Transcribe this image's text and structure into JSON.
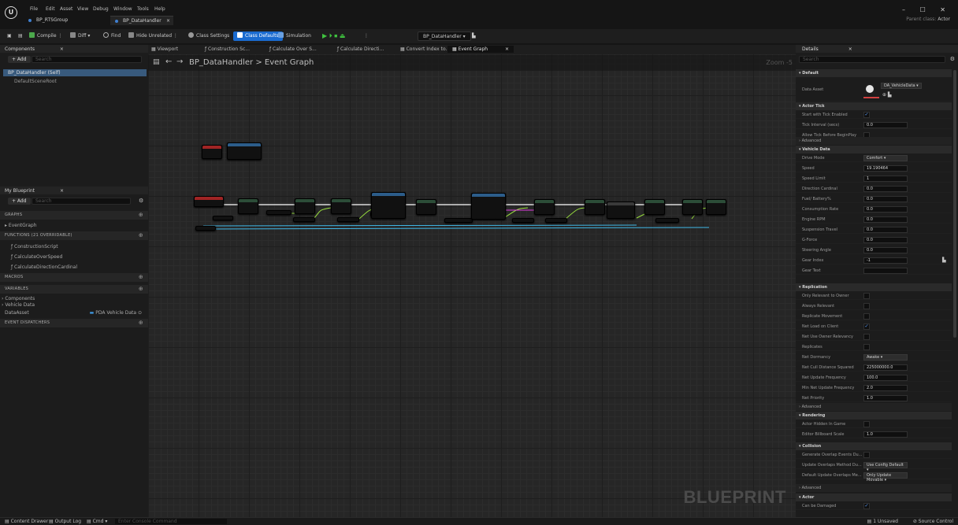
{
  "menu": [
    "File",
    "Edit",
    "Asset",
    "View",
    "Debug",
    "Window",
    "Tools",
    "Help"
  ],
  "doc_tabs": [
    {
      "label": "BP_RTSGroup",
      "color": "#3f7fd0"
    },
    {
      "label": "BP_DataHandler",
      "color": "#3f7fd0"
    }
  ],
  "doc_tab_close": "×",
  "window_controls": "–  ☐  ✕",
  "parent_class": {
    "label": "Parent class:",
    "value": "Actor"
  },
  "toolbar": {
    "compile": "Compile",
    "diff": "Diff ▾",
    "find": "Find",
    "hide_unrelated": "Hide Unrelated",
    "class_settings": "Class Settings",
    "class_defaults": "Class Defaults",
    "simulation": "Simulation",
    "play_controls": "▶ ⏵ ⏹ ⏏",
    "debug_target": "BP_DataHandler ▾"
  },
  "components": {
    "tab": "Components",
    "add": "+ Add",
    "search_placeholder": "Search",
    "self": "BP_DataHandler (Self)",
    "root": "DefaultSceneRoot"
  },
  "my_blueprint": {
    "tab": "My Blueprint",
    "add": "+ Add",
    "search_placeholder": "Search",
    "graphs_label": "GRAPHS",
    "event_graph": "EventGraph",
    "functions_label": "FUNCTIONS (21 OVERRIDABLE)",
    "functions": [
      "ConstructionScript",
      "CalculateOverSpeed",
      "CalculateDirectionCardinal"
    ],
    "macros_label": "MACROS",
    "variables_label": "VARIABLES",
    "var_groups": [
      "Components",
      "Vehicle Data"
    ],
    "variable": {
      "name": "DataAsset",
      "type": "PDA Vehicle Data"
    },
    "dispatchers_label": "EVENT DISPATCHERS"
  },
  "graph": {
    "tabs": [
      "Viewport",
      "Construction Sc...",
      "Calculate Over S...",
      "Calculate Directi...",
      "Convert Index to...",
      "Event Graph"
    ],
    "tab_close": "×",
    "breadcrumb": "BP_DataHandler > Event Graph",
    "zoom": "Zoom -5",
    "watermark": "BLUEPRINT"
  },
  "details": {
    "tab": "Details",
    "search_placeholder": "Search",
    "sections": {
      "default": "Default",
      "actor_tick": "Actor Tick",
      "advanced": "Advanced",
      "vehicle_data": "Vehicle Data",
      "replication": "Replication",
      "rendering": "Rendering",
      "collision": "Collision",
      "actor": "Actor"
    },
    "data_asset": {
      "label": "Data Asset",
      "value": "DA_VehicleData"
    },
    "tick": [
      {
        "label": "Start with Tick Enabled",
        "check": "✓"
      },
      {
        "label": "Tick Interval (secs)",
        "value": "0.0"
      },
      {
        "label": "Allow Tick Before BeginPlay",
        "check": ""
      }
    ],
    "vehicle": [
      {
        "label": "Drive Mode",
        "drop": "Comfort ▾"
      },
      {
        "label": "Speed",
        "value": "19.190464"
      },
      {
        "label": "Speed Limit",
        "value": "1"
      },
      {
        "label": "Direction Cardinal",
        "value": "0.0"
      },
      {
        "label": "Fuel/ Battery%",
        "value": "0.0"
      },
      {
        "label": "Consumption Rate",
        "value": "0.0"
      },
      {
        "label": "Engine RPM",
        "value": "0.0"
      },
      {
        "label": "Suspension Travel",
        "value": "0.0"
      },
      {
        "label": "G-Force",
        "value": "0.0"
      },
      {
        "label": "Steering Angle",
        "value": "0.0"
      },
      {
        "label": "Gear Index",
        "value": "-1"
      },
      {
        "label": "Gear Text",
        "value": ""
      }
    ],
    "replication": [
      {
        "label": "Only Relevant to Owner",
        "check": ""
      },
      {
        "label": "Always Relevant",
        "check": ""
      },
      {
        "label": "Replicate Movement",
        "check": ""
      },
      {
        "label": "Net Load on Client",
        "check": "✓"
      },
      {
        "label": "Net Use Owner Relevancy",
        "check": ""
      },
      {
        "label": "Replicates",
        "check": ""
      },
      {
        "label": "Net Dormancy",
        "drop": "Awake ▾"
      },
      {
        "label": "Net Cull Distance Squared",
        "value": "225000000.0"
      },
      {
        "label": "Net Update Frequency",
        "value": "100.0"
      },
      {
        "label": "Min Net Update Frequency",
        "value": "2.0"
      },
      {
        "label": "Net Priority",
        "value": "1.0"
      }
    ],
    "rendering": [
      {
        "label": "Actor Hidden In Game",
        "check": ""
      },
      {
        "label": "Editor Billboard Scale",
        "value": "1.0"
      }
    ],
    "collision": [
      {
        "label": "Generate Overlap Events Du...",
        "check": ""
      },
      {
        "label": "Update Overlaps Method Du...",
        "drop": "Use Config Default ▾"
      },
      {
        "label": "Default Update Overlaps Me...",
        "drop": "Only Update Movable ▾"
      }
    ],
    "actor": [
      {
        "label": "Can be Damaged",
        "check": "✓"
      }
    ]
  },
  "statusbar": {
    "content_drawer": "Content Drawer",
    "output_log": "Output Log",
    "cmd": "Cmd ▾",
    "console_placeholder": "Enter Console Command",
    "unsaved": "1 Unsaved",
    "source_control": "Source Control"
  },
  "colors": {
    "accent": "#1a6bd0",
    "exec_wire": "#ffffff",
    "float_wire": "#9be23e",
    "object_wire": "#3fb7e6",
    "struct_wire": "#e03fe0"
  }
}
